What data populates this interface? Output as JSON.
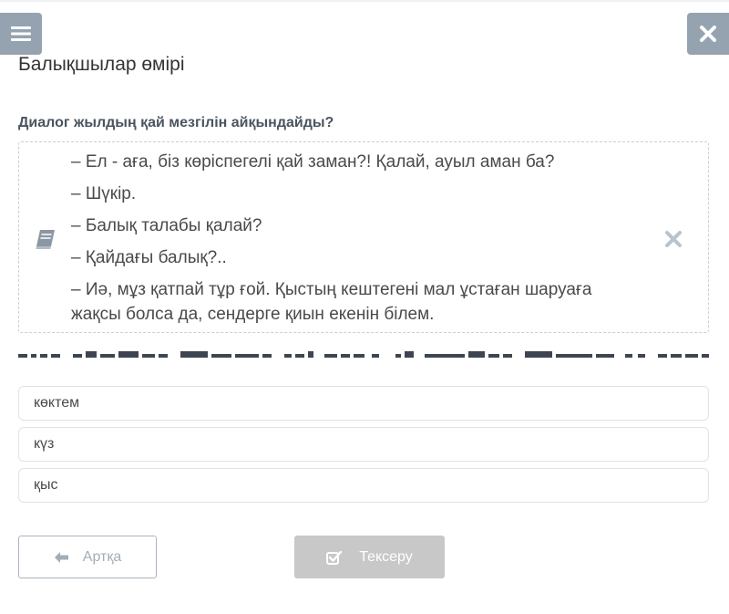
{
  "lesson": {
    "title": "Балықшылар өмірі"
  },
  "task": {
    "question": "Диалог жылдың қай мезгілін айқындайды?"
  },
  "dialog": {
    "lines": [
      "– Ел - аға, біз көріспегелі қай заман?! Қалай, ауыл аман ба?",
      "– Шүкір.",
      "– Балық талабы қалай?",
      "– Қайдағы балық?..",
      "– Иә, мұз қатпай тұр ғой. Қыстың кештегені мал ұстаған шаруаға жақсы болса да, сендерге қиын екенін білем."
    ]
  },
  "options": [
    "көктем",
    "күз",
    "қыс"
  ],
  "buttons": {
    "back_label": "Артқа",
    "check_label": "Тексеру"
  },
  "icons": {
    "menu": "hamburger-menu-icon",
    "close": "close-icon",
    "book": "book-icon",
    "dialog_close": "close-icon",
    "back": "arrow-left-icon",
    "check": "checkbox-check-icon"
  },
  "colors": {
    "header_button": "#95a3b0",
    "check_button": "#c8c8c8",
    "book_icon": "#8b97a3"
  }
}
